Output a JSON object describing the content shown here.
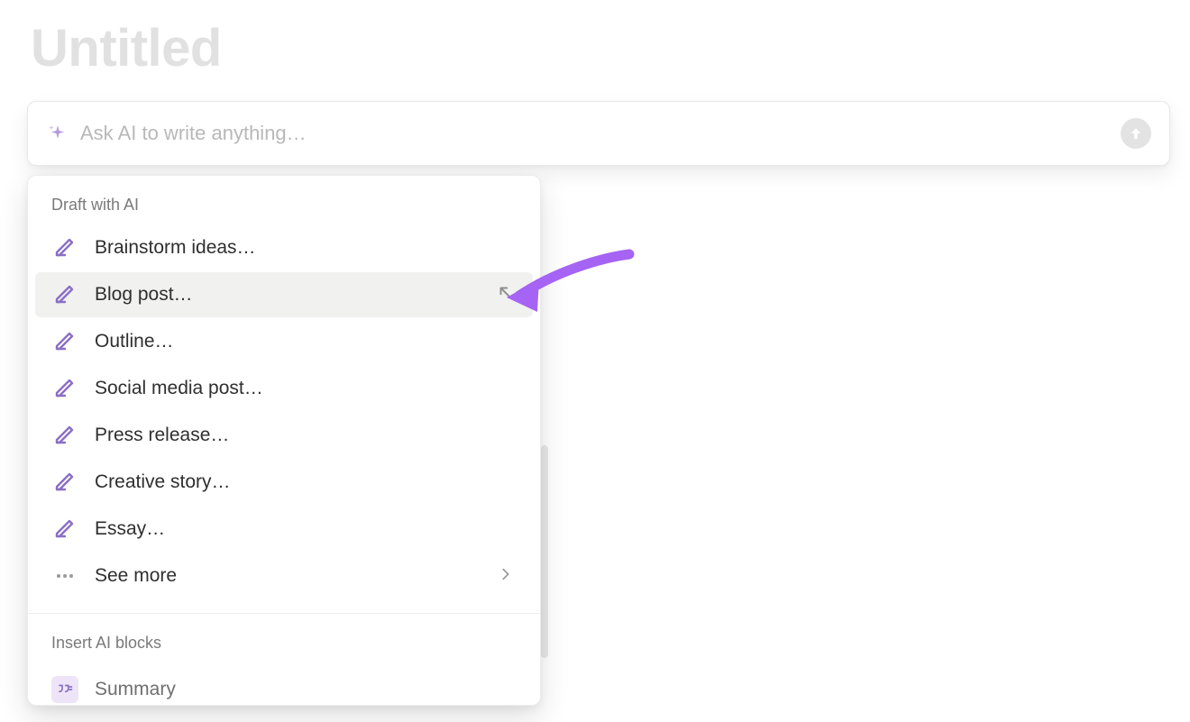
{
  "page": {
    "title": "Untitled"
  },
  "ai_bar": {
    "placeholder": "Ask AI to write anything…",
    "icon": "sparkle-icon",
    "submit_icon": "arrow-up-icon"
  },
  "dropdown": {
    "sections": [
      {
        "header": "Draft with AI",
        "items": [
          {
            "label": "Brainstorm ideas…",
            "icon": "pencil-icon",
            "hovered": false
          },
          {
            "label": "Blog post…",
            "icon": "pencil-icon",
            "hovered": true,
            "trailing_icon": "insert-arrow-icon"
          },
          {
            "label": "Outline…",
            "icon": "pencil-icon",
            "hovered": false
          },
          {
            "label": "Social media post…",
            "icon": "pencil-icon",
            "hovered": false
          },
          {
            "label": "Press release…",
            "icon": "pencil-icon",
            "hovered": false
          },
          {
            "label": "Creative story…",
            "icon": "pencil-icon",
            "hovered": false
          },
          {
            "label": "Essay…",
            "icon": "pencil-icon",
            "hovered": false
          },
          {
            "label": "See more",
            "icon": "ellipsis-icon",
            "hovered": false,
            "trailing_icon": "chevron-right-icon"
          }
        ]
      },
      {
        "header": "Insert AI blocks",
        "partial_item": {
          "label": "Summary",
          "icon": "quote-icon"
        }
      }
    ]
  },
  "annotation": {
    "arrow_color": "#a564f3"
  }
}
